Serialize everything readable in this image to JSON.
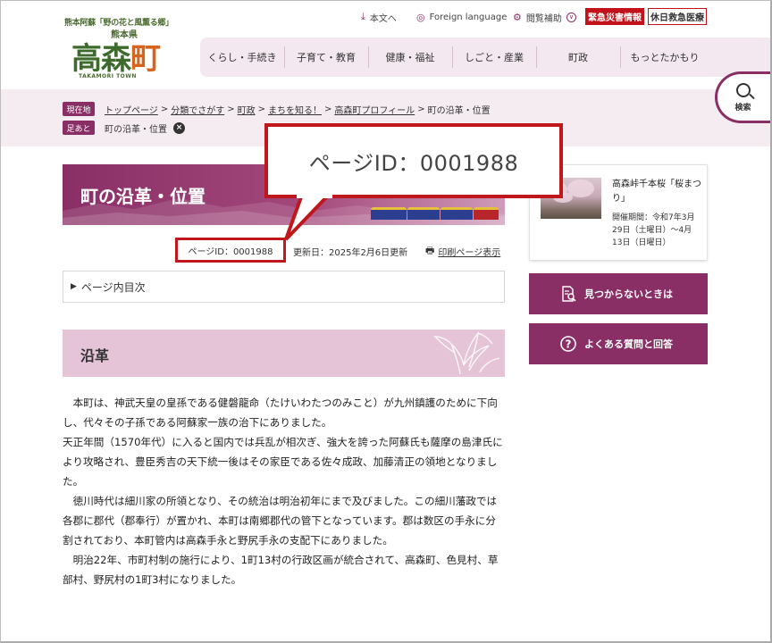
{
  "logo": {
    "tagline": "熊本阿蘇「野の花と風薫る郷」",
    "prefecture": "熊本県",
    "name_part1": "高森",
    "name_part2": "町",
    "romaji": "TAKAMORI TOWN"
  },
  "utility": {
    "honbun": "本文へ",
    "foreign": "Foreign language",
    "etsuran": "閲覧補助",
    "emergency": "緊急災害情報",
    "holiday": "休日救急医療"
  },
  "gnav": [
    "くらし・手続き",
    "子育て・教育",
    "健康・福祉",
    "しごと・産業",
    "町政",
    "もっとたかもり"
  ],
  "search": {
    "label": "検索"
  },
  "breadcrumb": {
    "current_tag": "現在地",
    "items": [
      "トップページ",
      "分類でさがす",
      "町政",
      "まちを知る！",
      "高森町プロフィール"
    ],
    "current": "町の沿革・位置",
    "footprint_tag": "足あと",
    "footprint_item": "町の沿革・位置"
  },
  "page": {
    "title": "町の沿革・位置",
    "page_id": "ページID：0001988",
    "updated": "更新日：2025年2月6日更新",
    "print": "印刷ページ表示",
    "toc": "ページ内目次",
    "section_heading": "沿革",
    "callout": "ページID：0001988",
    "paragraphs": [
      "本町は、神武天皇の皇孫である健磐龍命（たけいわたつのみこと）が九州鎮護のために下向し、代々その子孫である阿蘇家一族の治下にありました。",
      "天正年間（1570年代）に入ると国内では兵乱が相次ぎ、強大を誇った阿蘇氏も薩摩の島津氏により攻略され、豊臣秀吉の天下統一後はその家臣である佐々成政、加藤清正の領地となりました。",
      "徳川時代は細川家の所領となり、その統治は明治初年にまで及びました。この細川藩政では各郡に郡代（郡奉行）が置かれ、本町は南郷郡代の管下となっています。郡は数区の手永に分割されており、本町管内は高森手永と野尻手永の支配下にありました。",
      "明治22年、市町村制の施行により、1町13村の行政区画が統合されて、高森町、色見村、草部村、野尻村の1町3村になりました。"
    ]
  },
  "sidebar": {
    "event_title": "高森峠千本桜「桜まつり」",
    "event_date": "開催期間：令和7年3月29日（土曜日）～4月13日（日曜日）",
    "notfound": "見つからないときは",
    "faq": "よくある質問と回答"
  },
  "colors": {
    "brand": "#8a2f66",
    "brand_light": "#e4c4d6",
    "band": "#f5ecf1",
    "emergency": "#c4121a",
    "annotation": "#c0171d"
  },
  "icons": [
    "download-arrow-icon",
    "globe-icon",
    "gear-icon",
    "chevron-down-icon",
    "search-icon",
    "close-icon",
    "printer-icon",
    "triangle-right-icon",
    "document-search-icon",
    "question-icon",
    "lily-icon"
  ]
}
